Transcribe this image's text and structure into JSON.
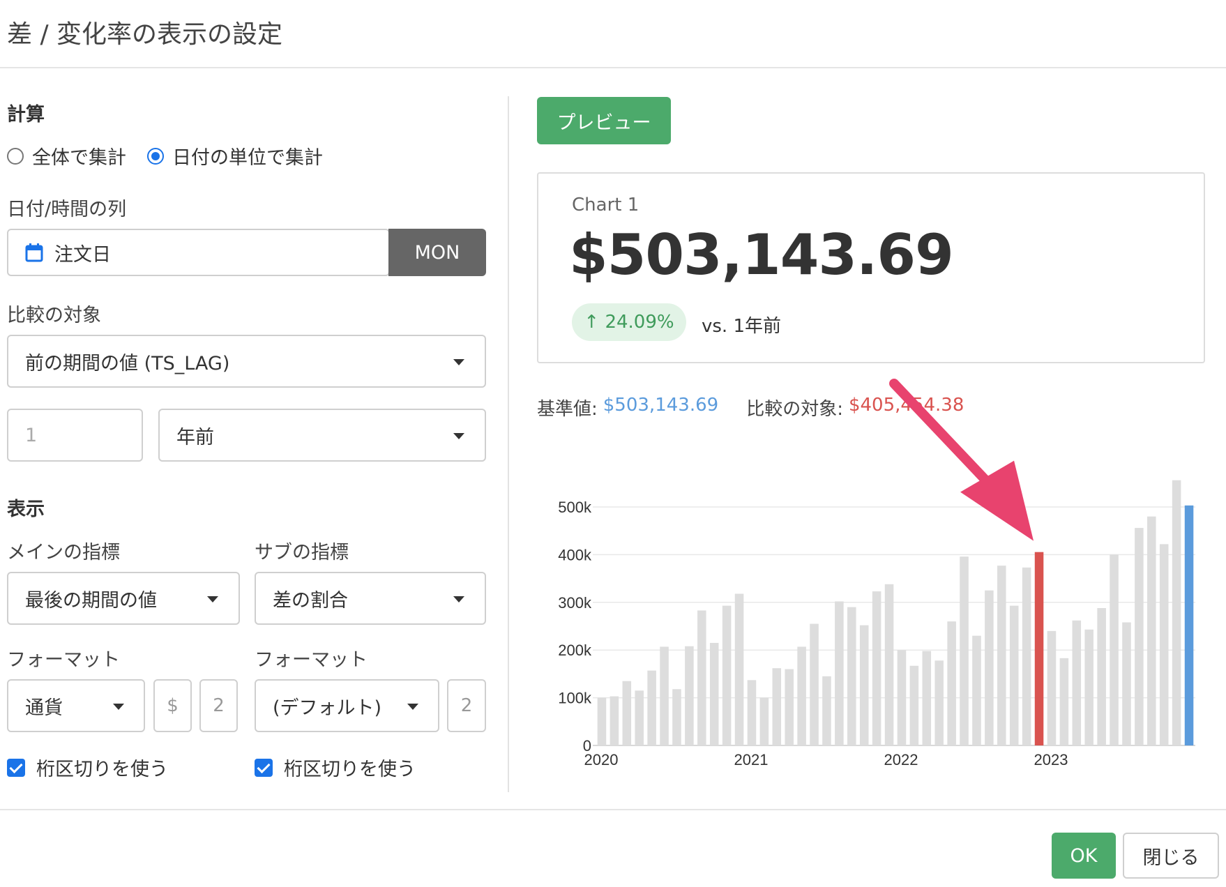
{
  "title": "差 / 変化率の表示の設定",
  "calc": {
    "section_label": "計算",
    "radio_all": "全体で集計",
    "radio_date": "日付の単位で集計",
    "date_column_label": "日付/時間の列",
    "date_column_value": "注文日",
    "date_unit": "MON"
  },
  "compare": {
    "label": "比較の対象",
    "method": "前の期間の値 (TS_LAG)",
    "offset_placeholder": "1",
    "offset_unit": "年前"
  },
  "display": {
    "section_label": "表示",
    "main_label": "メインの指標",
    "main_value": "最後の期間の値",
    "sub_label": "サブの指標",
    "sub_value": "差の割合",
    "main_format_label": "フォーマット",
    "main_format_value": "通貨",
    "main_currency_symbol": "$",
    "main_decimals": "2",
    "sub_format_label": "フォーマット",
    "sub_format_value": "(デフォルト)",
    "sub_decimals": "2",
    "main_separator_label": "桁区切りを使う",
    "sub_separator_label": "桁区切りを使う"
  },
  "preview": {
    "button_label": "プレビュー",
    "card_title": "Chart 1",
    "main_value": "$503,143.69",
    "change_value": "↑ 24.09%",
    "vs_label": "vs. 1年前",
    "base_label": "基準値:",
    "base_value": "$503,143.69",
    "compare_label": "比較の対象:",
    "compare_value": "$405,454.38"
  },
  "colors": {
    "accent_green": "#4caa6b",
    "bar_gray": "#dddddd",
    "highlight_red": "#d9534f",
    "highlight_blue": "#5b9bdc",
    "arrow_pink": "#e8436e"
  },
  "chart_data": {
    "type": "bar",
    "x_ticks": [
      "2020",
      "2021",
      "2022",
      "2023"
    ],
    "y_ticks": [
      "0",
      "100k",
      "200k",
      "300k",
      "400k",
      "500k"
    ],
    "ylim": [
      0,
      500000
    ],
    "values": [
      100000,
      103000,
      135000,
      115000,
      157000,
      207000,
      118000,
      208000,
      283000,
      215000,
      293000,
      318000,
      137000,
      100000,
      162000,
      160000,
      207000,
      255000,
      145000,
      302000,
      290000,
      252000,
      323000,
      338000,
      200000,
      167000,
      198000,
      178000,
      260000,
      396000,
      230000,
      325000,
      377000,
      293000,
      373000,
      405454,
      240000,
      183000,
      262000,
      243000,
      288000,
      400000,
      258000,
      456000,
      480000,
      422000,
      556000,
      503144
    ],
    "highlight_compare_index": 35,
    "highlight_base_index": 47,
    "annotations": [
      "arrow pointing to comparison bar"
    ]
  },
  "footer": {
    "ok_label": "OK",
    "close_label": "閉じる"
  }
}
